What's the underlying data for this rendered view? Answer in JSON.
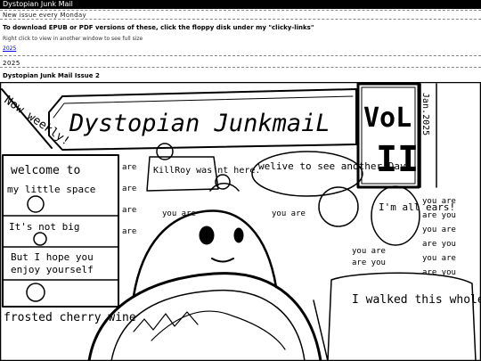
{
  "site": {
    "title": "Dystopian Junk Mail",
    "subtitle": "New issue every Monday"
  },
  "intro": {
    "download_text": "To download EPUB or PDF versions of these, click the floppy disk under my \"clicky-links\"",
    "hint_text": "Right click to view in another window to see full size",
    "year_link": "2025"
  },
  "section": {
    "year": "2025",
    "issue_title": "Dystopian Junk Mail Issue 2"
  },
  "comic": {
    "corner_note": "Now weekly!",
    "banner_title": "Dystopian JunkmaiL",
    "vol_label": "VoL",
    "vol_number": "II",
    "side_vertical": "Jan.2025",
    "left_panel": {
      "line1": "welcome to",
      "line2": "my little space",
      "line3": "It's not big",
      "line4": "But I hope you",
      "line5": "enjoy yourself"
    },
    "bottom_left": "frosted cherry wine",
    "killroy_text": "KillRoy was'nt here.",
    "bubble_live": "welive to see another Day",
    "bubble_ears": "I'm all ears!",
    "walked_text": "I walked this whole city until my feet Blistered and",
    "are_word": "are",
    "you_are": "you are",
    "are_you": "are you"
  },
  "colors": {
    "titlebar_bg": "#000000",
    "link": "#0000ee"
  }
}
